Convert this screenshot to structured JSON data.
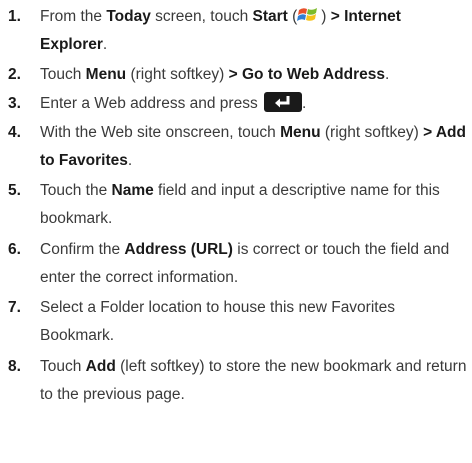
{
  "steps": [
    {
      "num": "1.",
      "parts": [
        {
          "t": "From the "
        },
        {
          "t": "Today",
          "b": true
        },
        {
          "t": " screen, touch "
        },
        {
          "t": "Start",
          "b": true
        },
        {
          "t": " ("
        },
        {
          "icon": "windows-start-icon"
        },
        {
          "t": ") "
        },
        {
          "t": "> Internet Explorer",
          "b": true
        },
        {
          "t": "."
        }
      ]
    },
    {
      "num": "2.",
      "parts": [
        {
          "t": "Touch "
        },
        {
          "t": "Menu",
          "b": true
        },
        {
          "t": " (right softkey) "
        },
        {
          "t": "> Go to Web Address",
          "b": true
        },
        {
          "t": "."
        }
      ]
    },
    {
      "num": "3.",
      "parts": [
        {
          "t": "Enter a Web address and press "
        },
        {
          "icon": "enter-key-icon"
        },
        {
          "t": "."
        }
      ]
    },
    {
      "num": "4.",
      "parts": [
        {
          "t": "With the Web site onscreen, touch "
        },
        {
          "t": "Menu",
          "b": true
        },
        {
          "t": " (right softkey) "
        },
        {
          "t": "> Add to Favorites",
          "b": true
        },
        {
          "t": "."
        }
      ]
    },
    {
      "num": "5.",
      "parts": [
        {
          "t": "Touch the "
        },
        {
          "t": "Name",
          "b": true
        },
        {
          "t": " field and input a descriptive name for this bookmark."
        }
      ]
    },
    {
      "num": "6.",
      "parts": [
        {
          "t": "Confirm the "
        },
        {
          "t": "Address (URL)",
          "b": true
        },
        {
          "t": " is correct or touch the field and enter the correct information."
        }
      ]
    },
    {
      "num": "7.",
      "parts": [
        {
          "t": "Select a Folder location to house this new Favorites Bookmark."
        }
      ]
    },
    {
      "num": "8.",
      "parts": [
        {
          "t": "Touch "
        },
        {
          "t": "Add",
          "b": true
        },
        {
          "t": " (left softkey) to store the new bookmark and return to the previous page."
        }
      ]
    }
  ]
}
